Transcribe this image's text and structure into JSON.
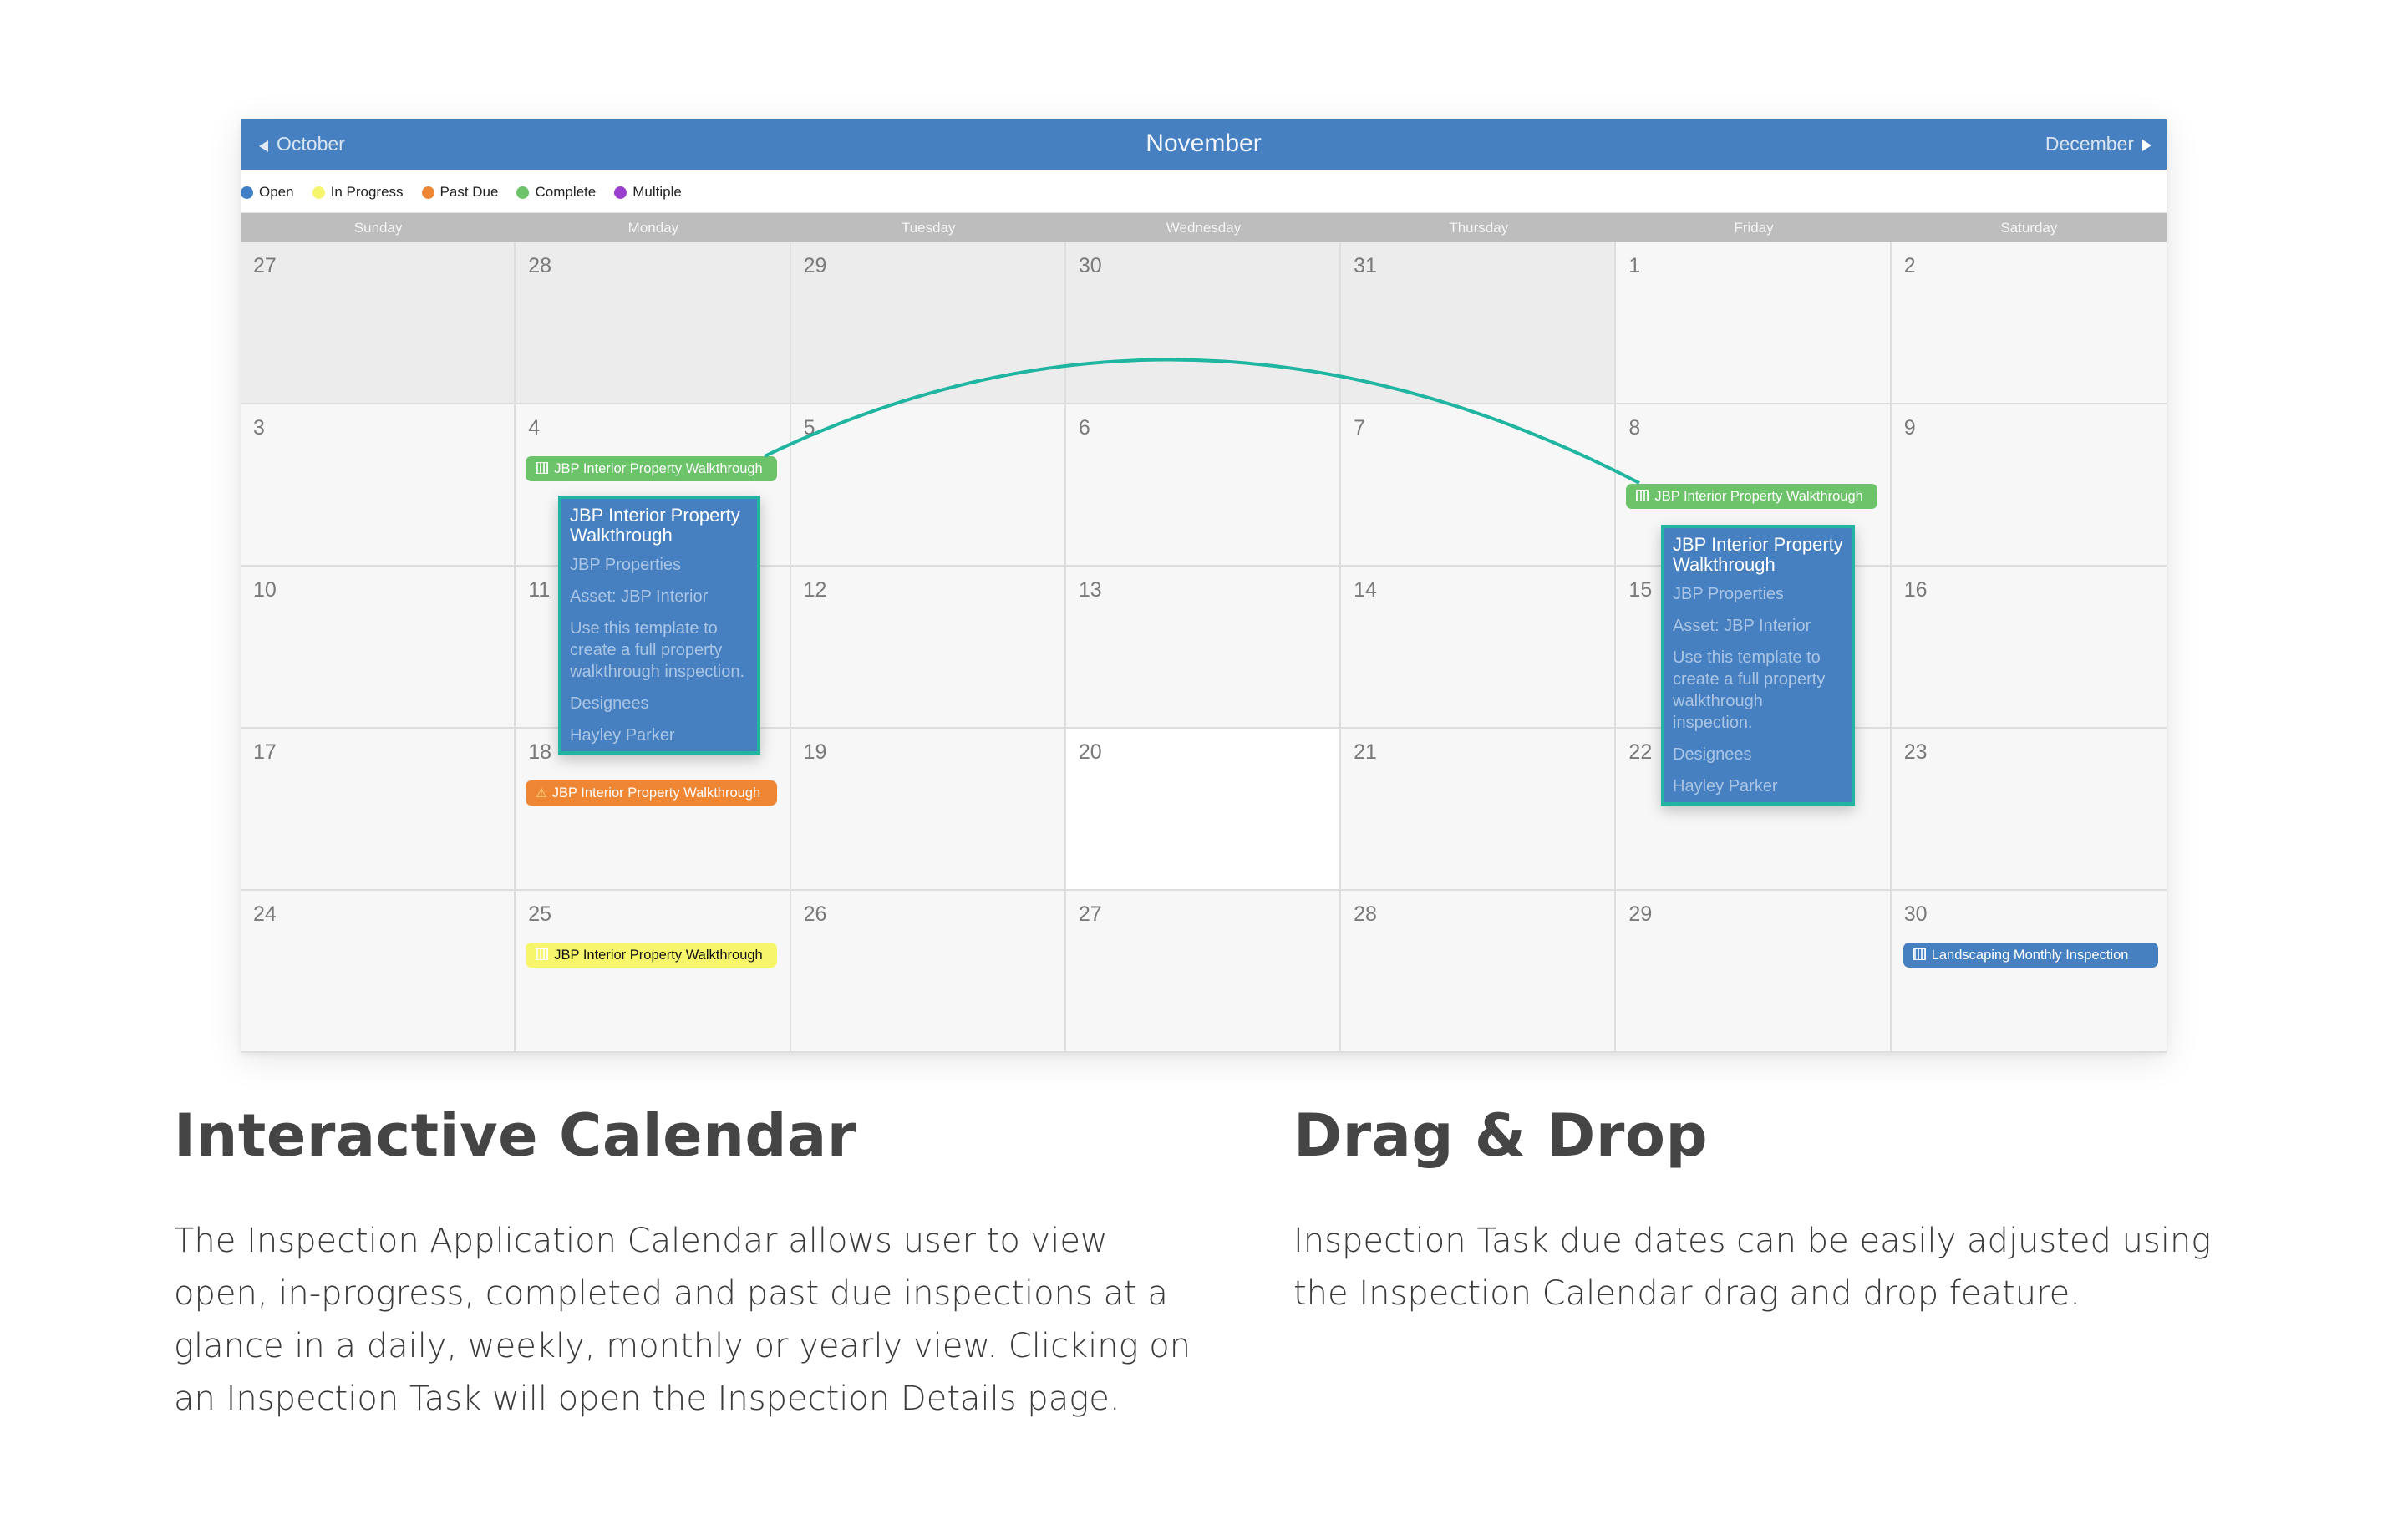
{
  "calendar": {
    "month_title": "November",
    "prev_month_label": "October",
    "next_month_label": "December",
    "legend": [
      {
        "label": "Open",
        "color": "#3f7fc8"
      },
      {
        "label": "In Progress",
        "color": "#f7f56c"
      },
      {
        "label": "Past Due",
        "color": "#ef8634"
      },
      {
        "label": "Complete",
        "color": "#6cc36a"
      },
      {
        "label": "Multiple",
        "color": "#9b3fd1"
      }
    ],
    "days_of_week": [
      "Sunday",
      "Monday",
      "Tuesday",
      "Wednesday",
      "Thursday",
      "Friday",
      "Saturday"
    ],
    "weeks": [
      [
        {
          "day": "27",
          "other": true
        },
        {
          "day": "28",
          "other": true
        },
        {
          "day": "29",
          "other": true
        },
        {
          "day": "30",
          "other": true
        },
        {
          "day": "31",
          "other": true
        },
        {
          "day": "1"
        },
        {
          "day": "2"
        }
      ],
      [
        {
          "day": "3"
        },
        {
          "day": "4"
        },
        {
          "day": "5"
        },
        {
          "day": "6"
        },
        {
          "day": "7"
        },
        {
          "day": "8"
        },
        {
          "day": "9"
        }
      ],
      [
        {
          "day": "10"
        },
        {
          "day": "11"
        },
        {
          "day": "12"
        },
        {
          "day": "13"
        },
        {
          "day": "14"
        },
        {
          "day": "15"
        },
        {
          "day": "16"
        }
      ],
      [
        {
          "day": "17"
        },
        {
          "day": "18"
        },
        {
          "day": "19"
        },
        {
          "day": "20",
          "today": true
        },
        {
          "day": "21"
        },
        {
          "day": "22"
        },
        {
          "day": "23"
        }
      ],
      [
        {
          "day": "24"
        },
        {
          "day": "25"
        },
        {
          "day": "26"
        },
        {
          "day": "27"
        },
        {
          "day": "28"
        },
        {
          "day": "29"
        },
        {
          "day": "30"
        }
      ]
    ],
    "events": [
      {
        "id": "ev-nov4",
        "date": "4",
        "title": "JBP Interior Property Walkthrough",
        "status": "Complete",
        "color": "#6cc36a",
        "text_color": "#ffffff",
        "icon": "calendar-grid-icon"
      },
      {
        "id": "ev-nov8",
        "date": "8",
        "title": "JBP Interior Property Walkthrough",
        "status": "Complete",
        "color": "#6cc36a",
        "text_color": "#ffffff",
        "icon": "calendar-grid-icon"
      },
      {
        "id": "ev-nov18",
        "date": "18",
        "title": "JBP Interior Property Walkthrough",
        "status": "Past Due",
        "color": "#ef8634",
        "text_color": "#ffffff",
        "icon": "warning-icon"
      },
      {
        "id": "ev-nov25",
        "date": "25",
        "title": "JBP Interior Property Walkthrough",
        "status": "In Progress",
        "color": "#f7f56c",
        "text_color": "#111111",
        "icon": "calendar-grid-icon"
      },
      {
        "id": "ev-nov30",
        "date": "30",
        "title": "Landscaping Monthly Inspection",
        "status": "Open",
        "color": "#4680c1",
        "text_color": "#ffffff",
        "icon": "calendar-grid-icon"
      }
    ],
    "popup": {
      "title": "JBP Interior Property Walkthrough",
      "company": "JBP Properties",
      "asset": "Asset: JBP Interior",
      "description": "Use this template to create a full property walkthrough inspection.",
      "designees_label": "Designees",
      "designee": "Hayley Parker"
    },
    "drag": {
      "from_date": "4",
      "to_date": "8",
      "line_color": "#1fb5a0"
    }
  },
  "sections": [
    {
      "title": "Interactive Calendar",
      "body": "The Inspection Application Calendar allows user to view open, in-progress, completed and past due inspections at a glance in a daily, weekly, monthly or yearly view. Clicking on an Inspection Task will open the Inspection Details page."
    },
    {
      "title": "Drag & Drop",
      "body": "Inspection Task due dates can be easily adjusted using the Inspection Calendar drag and drop feature."
    }
  ]
}
